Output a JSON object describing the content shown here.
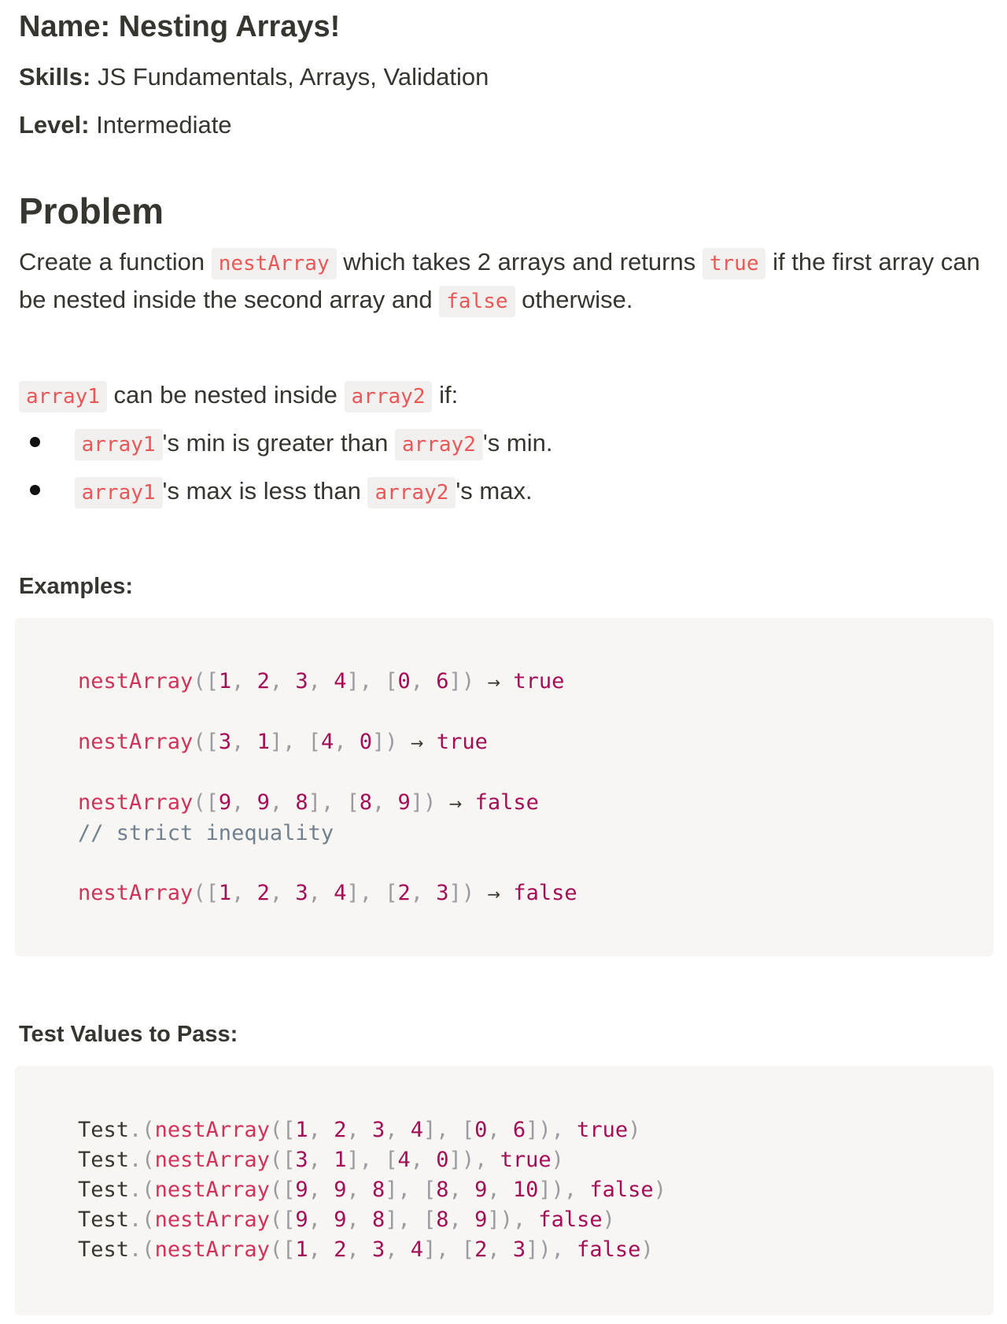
{
  "meta": {
    "name_label": "Name:",
    "name_value": "Nesting Arrays!",
    "skills_label": "Skills:",
    "skills_value": "JS Fundamentals, Arrays, Validation",
    "level_label": "Level:",
    "level_value": "Intermediate"
  },
  "problem": {
    "heading": "Problem",
    "text_1": "Create a function",
    "code_fn": "nestArray",
    "text_2": "which takes 2 arrays and returns",
    "code_true": "true",
    "text_3": "if the first array can be nested inside the second array and",
    "code_false": "false",
    "text_4": "otherwise."
  },
  "condition": {
    "code_a1": "array1",
    "text_1": "can be nested inside",
    "code_a2": "array2",
    "text_2": "if:",
    "bullets": [
      {
        "code_a": "array1",
        "text_a": "'s min is greater than",
        "code_b": "array2",
        "text_b": "'s min."
      },
      {
        "code_a": "array1",
        "text_a": "'s max is less than",
        "code_b": "array2",
        "text_b": "'s max."
      }
    ]
  },
  "examples": {
    "heading": "Examples:",
    "fn": "nestArray",
    "arrow": "→",
    "comment": "// strict inequality",
    "items": [
      {
        "a": [
          "1",
          "2",
          "3",
          "4"
        ],
        "b": [
          "0",
          "6"
        ],
        "result": "true"
      },
      {
        "a": [
          "3",
          "1"
        ],
        "b": [
          "4",
          "0"
        ],
        "result": "true"
      },
      {
        "a": [
          "9",
          "9",
          "8"
        ],
        "b": [
          "8",
          "9"
        ],
        "result": "false"
      },
      {
        "a": [
          "1",
          "2",
          "3",
          "4"
        ],
        "b": [
          "2",
          "3"
        ],
        "result": "false"
      }
    ]
  },
  "tests": {
    "heading": "Test Values to Pass:",
    "obj": "Test",
    "fn": "nestArray",
    "items": [
      {
        "a": [
          "1",
          "2",
          "3",
          "4"
        ],
        "b": [
          "0",
          "6"
        ],
        "result": "true"
      },
      {
        "a": [
          "3",
          "1"
        ],
        "b": [
          "4",
          "0"
        ],
        "result": "true"
      },
      {
        "a": [
          "9",
          "9",
          "8"
        ],
        "b": [
          "8",
          "9",
          "10"
        ],
        "result": "false"
      },
      {
        "a": [
          "9",
          "9",
          "8"
        ],
        "b": [
          "8",
          "9"
        ],
        "result": "false"
      },
      {
        "a": [
          "1",
          "2",
          "3",
          "4"
        ],
        "b": [
          "2",
          "3"
        ],
        "result": "false"
      }
    ]
  }
}
